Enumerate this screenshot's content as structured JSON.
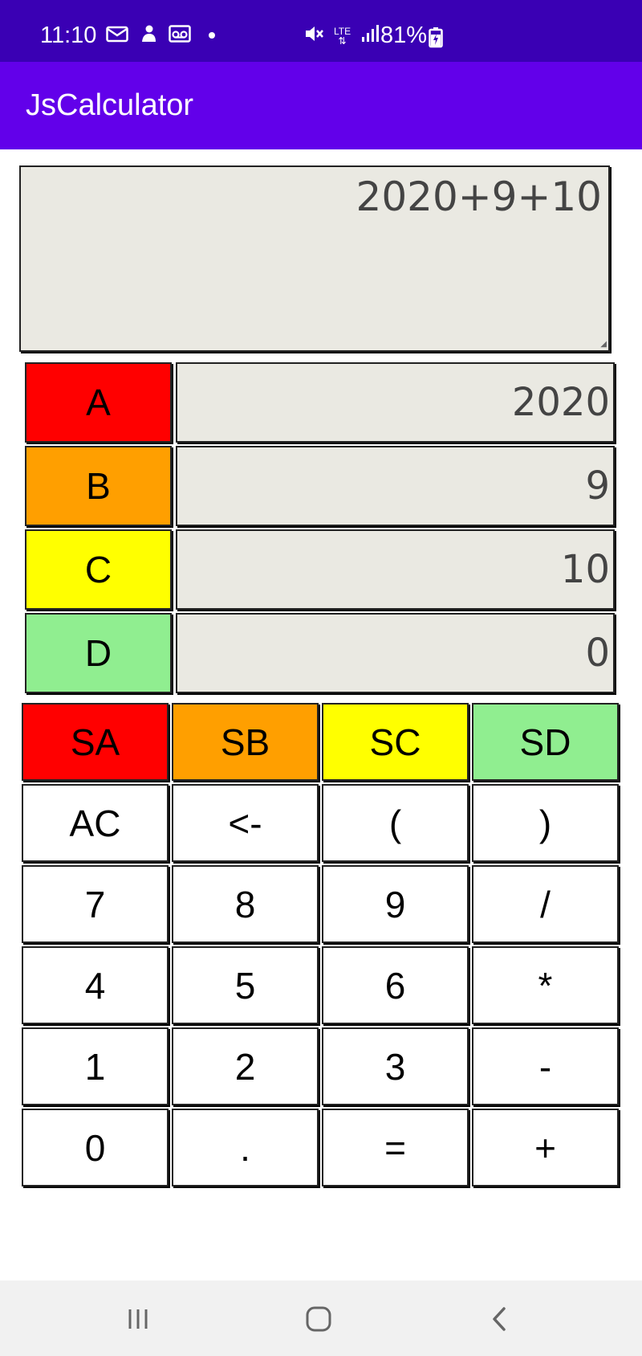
{
  "status_bar": {
    "time": "11:10",
    "battery": "81%",
    "icons_left": [
      "mail-icon",
      "notification-icon",
      "voicemail-icon",
      "dot-icon"
    ],
    "icons_right": [
      "mute-icon",
      "lte-icon",
      "signal-icon"
    ],
    "lte_label": "LTE"
  },
  "app": {
    "title": "JsCalculator",
    "bar_color": "#6200ea",
    "status_color": "#3a00b4"
  },
  "expression": {
    "value": "2020+9+10"
  },
  "variables": [
    {
      "label": "A",
      "value": "2020",
      "color": "#ff0000"
    },
    {
      "label": "B",
      "value": "9",
      "color": "#ff9f00"
    },
    {
      "label": "C",
      "value": "10",
      "color": "#ffff00"
    },
    {
      "label": "D",
      "value": "0",
      "color": "#90ee90"
    }
  ],
  "keys": [
    {
      "label": "SA",
      "color": "#ff0000"
    },
    {
      "label": "SB",
      "color": "#ff9f00"
    },
    {
      "label": "SC",
      "color": "#ffff00"
    },
    {
      "label": "SD",
      "color": "#90ee90"
    },
    {
      "label": "AC"
    },
    {
      "label": "<-"
    },
    {
      "label": "("
    },
    {
      "label": ")"
    },
    {
      "label": "7"
    },
    {
      "label": "8"
    },
    {
      "label": "9"
    },
    {
      "label": "/"
    },
    {
      "label": "4"
    },
    {
      "label": "5"
    },
    {
      "label": "6"
    },
    {
      "label": "*"
    },
    {
      "label": "1"
    },
    {
      "label": "2"
    },
    {
      "label": "3"
    },
    {
      "label": "-"
    },
    {
      "label": "0"
    },
    {
      "label": "."
    },
    {
      "label": "="
    },
    {
      "label": "+"
    }
  ],
  "nav": {
    "buttons": [
      "recent-apps-icon",
      "home-icon",
      "back-icon"
    ]
  }
}
